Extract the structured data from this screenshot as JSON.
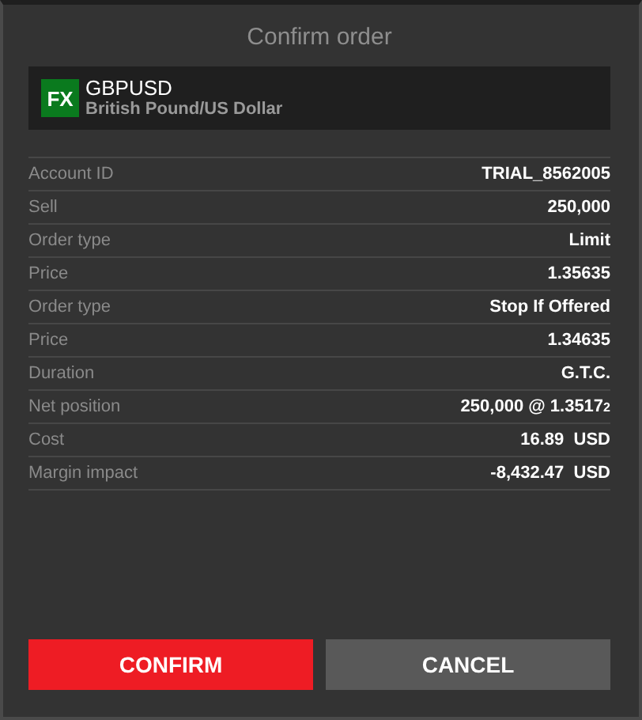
{
  "title": "Confirm order",
  "instrument": {
    "badge": "FX",
    "symbol": "GBPUSD",
    "description": "British Pound/US Dollar"
  },
  "rows": [
    {
      "label": "Account ID",
      "value": "TRIAL_8562005"
    },
    {
      "label": "Sell",
      "value": "250,000"
    },
    {
      "label": "Order type",
      "value": "Limit"
    },
    {
      "label": "Price",
      "value": "1.35635"
    },
    {
      "label": "Order type",
      "value": "Stop If Offered"
    },
    {
      "label": "Price",
      "value": "1.34635"
    },
    {
      "label": "Duration",
      "value": "G.T.C."
    },
    {
      "label": "Net position",
      "value": "250,000 @ 1.3517$_{2}$"
    },
    {
      "label": "Cost",
      "value": "16.89  USD"
    },
    {
      "label": "Margin impact",
      "value": "-8,432.47  USD"
    }
  ],
  "buttons": [
    {
      "label": "CONFIRM",
      "kind": "primary"
    },
    {
      "label": "CANCEL",
      "kind": "secondary"
    }
  ]
}
